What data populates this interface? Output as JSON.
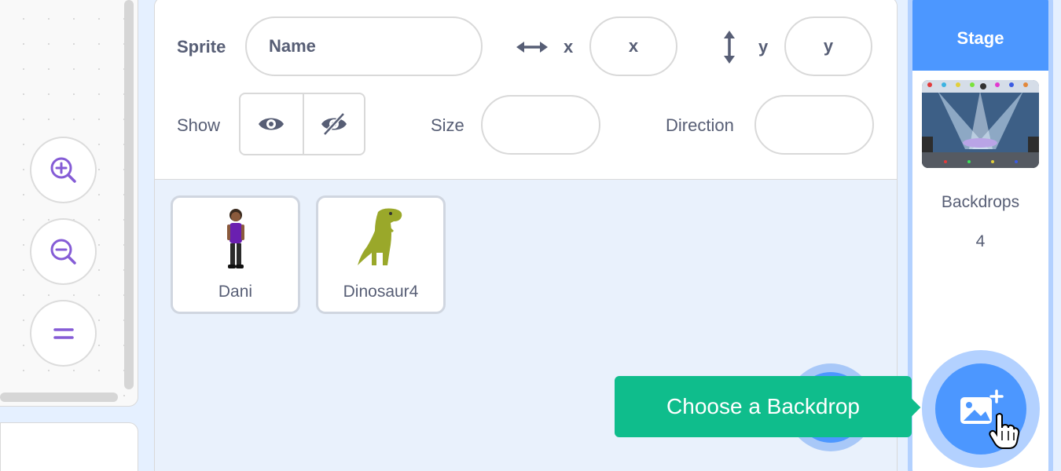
{
  "sprite_info": {
    "sprite_label": "Sprite",
    "name_placeholder": "Name",
    "x_label": "x",
    "x_placeholder": "x",
    "y_label": "y",
    "y_placeholder": "y",
    "show_label": "Show",
    "size_label": "Size",
    "direction_label": "Direction"
  },
  "sprites": [
    {
      "name": "Dani"
    },
    {
      "name": "Dinosaur4"
    }
  ],
  "stage": {
    "title": "Stage",
    "backdrops_label": "Backdrops",
    "backdrops_count": "4"
  },
  "tooltip": {
    "text": "Choose a Backdrop"
  },
  "colors": {
    "accent_blue": "#4c97ff",
    "tooltip_green": "#0fbd8c",
    "text_gray": "#575e75"
  }
}
